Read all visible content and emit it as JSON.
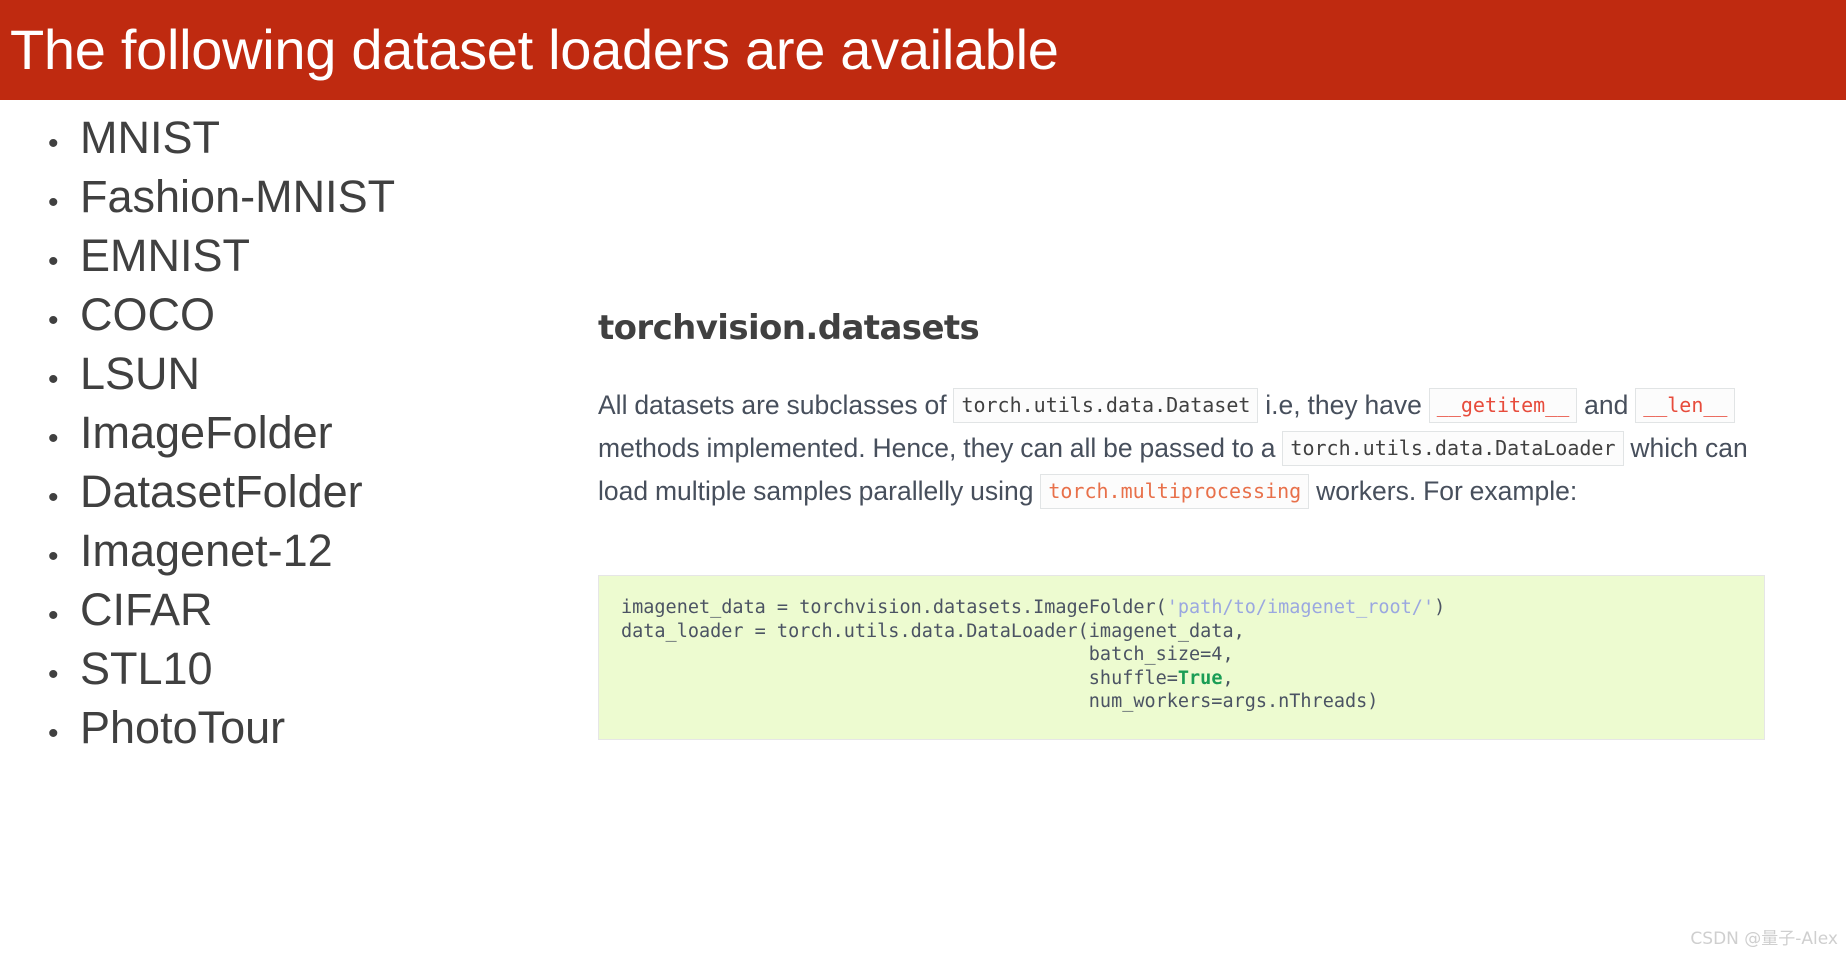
{
  "slide": {
    "title": "The following dataset loaders are available",
    "title_bar_color": "#bf2a10",
    "background_color": "#ffffff"
  },
  "bullets": {
    "marker": "•",
    "items": [
      {
        "label": "MNIST"
      },
      {
        "label": "Fashion-MNIST"
      },
      {
        "label": "EMNIST"
      },
      {
        "label": "COCO"
      },
      {
        "label": "LSUN"
      },
      {
        "label": "ImageFolder"
      },
      {
        "label": "DatasetFolder"
      },
      {
        "label": "Imagenet-12"
      },
      {
        "label": "CIFAR"
      },
      {
        "label": "STL10"
      },
      {
        "label": "PhotoTour"
      }
    ]
  },
  "doc": {
    "heading": "torchvision.datasets",
    "paragraph": {
      "part1": "All datasets are subclasses of ",
      "code1": "torch.utils.data.Dataset",
      "part2": " i.e, they have ",
      "code2": "__getitem__",
      "part3": " and ",
      "code3": "__len__",
      "part4": " methods implemented. Hence, they can all be passed to a ",
      "code4": "torch.utils.data.DataLoader",
      "part5": " which can load multiple samples parallelly using ",
      "code5": "torch.multiprocessing",
      "part6": " workers. For example:"
    },
    "code_block": {
      "background_color": "#edfbd0",
      "line1_a": "imagenet_data = torchvision.datasets.ImageFolder(",
      "line1_str": "'path/to/imagenet_root/'",
      "line1_b": ")",
      "line2": "data_loader = torch.utils.data.DataLoader(imagenet_data,",
      "line3": "                                          batch_size=4,",
      "line4_a": "                                          shuffle=",
      "line4_kw": "True",
      "line4_b": ",",
      "line5": "                                          num_workers=args.nThreads)"
    }
  },
  "watermark": {
    "text": "CSDN @量子-Alex"
  }
}
